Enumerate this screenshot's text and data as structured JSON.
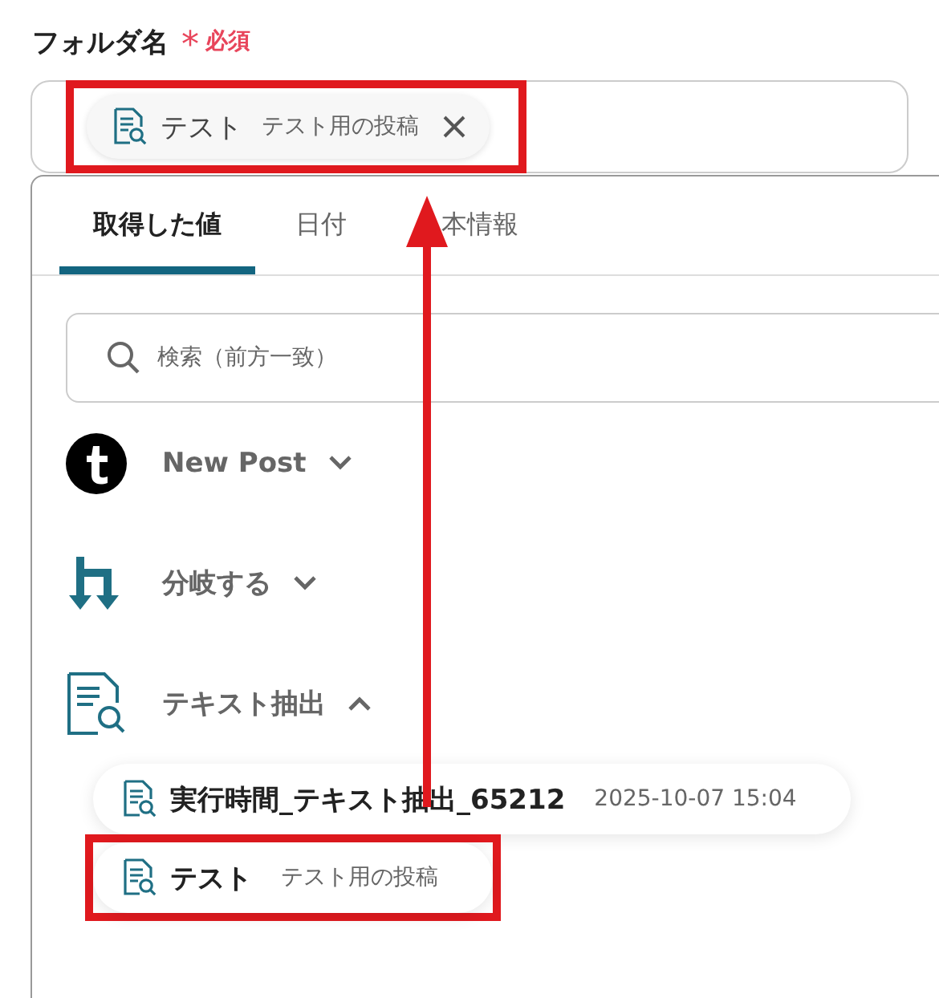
{
  "field": {
    "label": "フォルダ名",
    "required_mark": "*",
    "required": "必須",
    "chip": {
      "title": "テスト",
      "subtitle": "テスト用の投稿",
      "highlighted": true
    }
  },
  "tabs": [
    {
      "label": "取得した値",
      "selected": true
    },
    {
      "label": "日付",
      "selected": false
    },
    {
      "label": "本情報",
      "selected": false
    }
  ],
  "search": {
    "placeholder": "検索（前方一致）"
  },
  "groups": [
    {
      "name": "New Post",
      "kind": "tumblr",
      "expanded": false
    },
    {
      "name": "分岐する",
      "kind": "branch",
      "expanded": false
    },
    {
      "name": "テキスト抽出",
      "kind": "text",
      "expanded": true,
      "items": [
        {
          "title": "実行時間_テキスト抽出_65212",
          "meta": "2025-10-07 15:04",
          "highlighted": false
        },
        {
          "title": "テスト",
          "meta": "テスト用の投稿",
          "highlighted": true
        }
      ]
    }
  ],
  "annotation_arrow": true
}
